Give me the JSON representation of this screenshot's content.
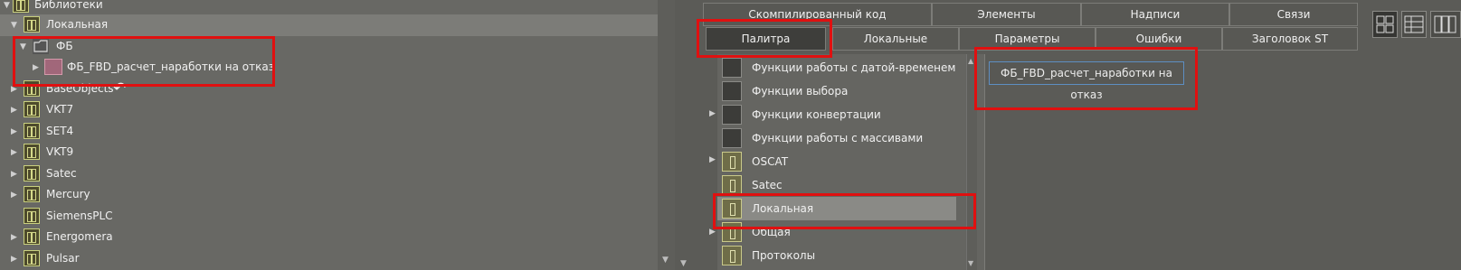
{
  "tree": {
    "root": "Библиотеки",
    "local": "Локальная",
    "fb_folder": "ФБ",
    "fb_item": "ФБ_FBD_расчет_наработки на отказ",
    "items": [
      "BaseObjects",
      "VKT7",
      "SET4",
      "VKT9",
      "Satec",
      "Mercury",
      "SiemensPLC",
      "Energomera",
      "Pulsar"
    ]
  },
  "tabs_row1": [
    "Скомпилированный код",
    "Элементы",
    "Надписи",
    "Связи"
  ],
  "tabs_row2": [
    "Палитра",
    "Локальные",
    "Параметры",
    "Ошибки",
    "Заголовок ST"
  ],
  "palette": [
    {
      "label": "Функции работы с датой-временем",
      "icon": "folder-icon"
    },
    {
      "label": "Функции выбора",
      "icon": "folder-icon"
    },
    {
      "label": "Функции конвертации",
      "icon": "folder-icon"
    },
    {
      "label": "Функции работы с массивами",
      "icon": "folder-icon"
    },
    {
      "label": "OSCAT",
      "icon": "library-icon"
    },
    {
      "label": "Satec",
      "icon": "library-icon"
    },
    {
      "label": "Локальная",
      "icon": "library-icon"
    },
    {
      "label": "Общая",
      "icon": "library-icon"
    },
    {
      "label": "Протоколы",
      "icon": "library-icon"
    }
  ],
  "canvas_block": "ФБ_FBD_расчет_наработки на отказ",
  "colors": {
    "highlight": "#e01010",
    "block_border": "#5d8ec2"
  }
}
